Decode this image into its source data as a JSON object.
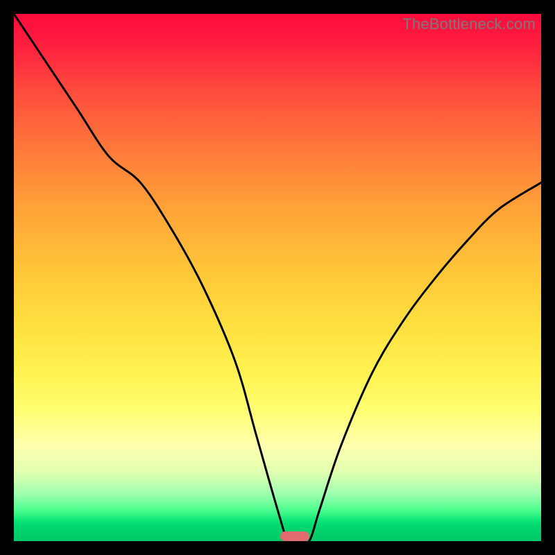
{
  "watermark": "TheBottleneck.com",
  "chart_data": {
    "type": "line",
    "title": "",
    "xlabel": "",
    "ylabel": "",
    "xlim": [
      0,
      100
    ],
    "ylim": [
      0,
      100
    ],
    "x": [
      0,
      6,
      12,
      18,
      24,
      30,
      36,
      42,
      46,
      50,
      52,
      54,
      56,
      58,
      62,
      68,
      74,
      80,
      86,
      92,
      100
    ],
    "values": [
      100,
      91,
      82,
      73,
      68,
      59,
      48,
      34,
      20,
      6,
      0,
      0,
      0,
      6,
      18,
      32,
      42,
      50,
      57,
      63,
      68
    ],
    "marker": {
      "x_start": 50.5,
      "x_end": 56.0,
      "y": 0
    },
    "background_gradient": {
      "direction": "vertical",
      "stops": [
        {
          "pos": 0,
          "color": "#ff0a3c"
        },
        {
          "pos": 50,
          "color": "#ffc438"
        },
        {
          "pos": 78,
          "color": "#ffff80"
        },
        {
          "pos": 100,
          "color": "#00c868"
        }
      ]
    }
  },
  "colors": {
    "frame": "#000000",
    "curve": "#000000",
    "marker": "#e06a6e",
    "watermark": "#7a7a7a"
  }
}
